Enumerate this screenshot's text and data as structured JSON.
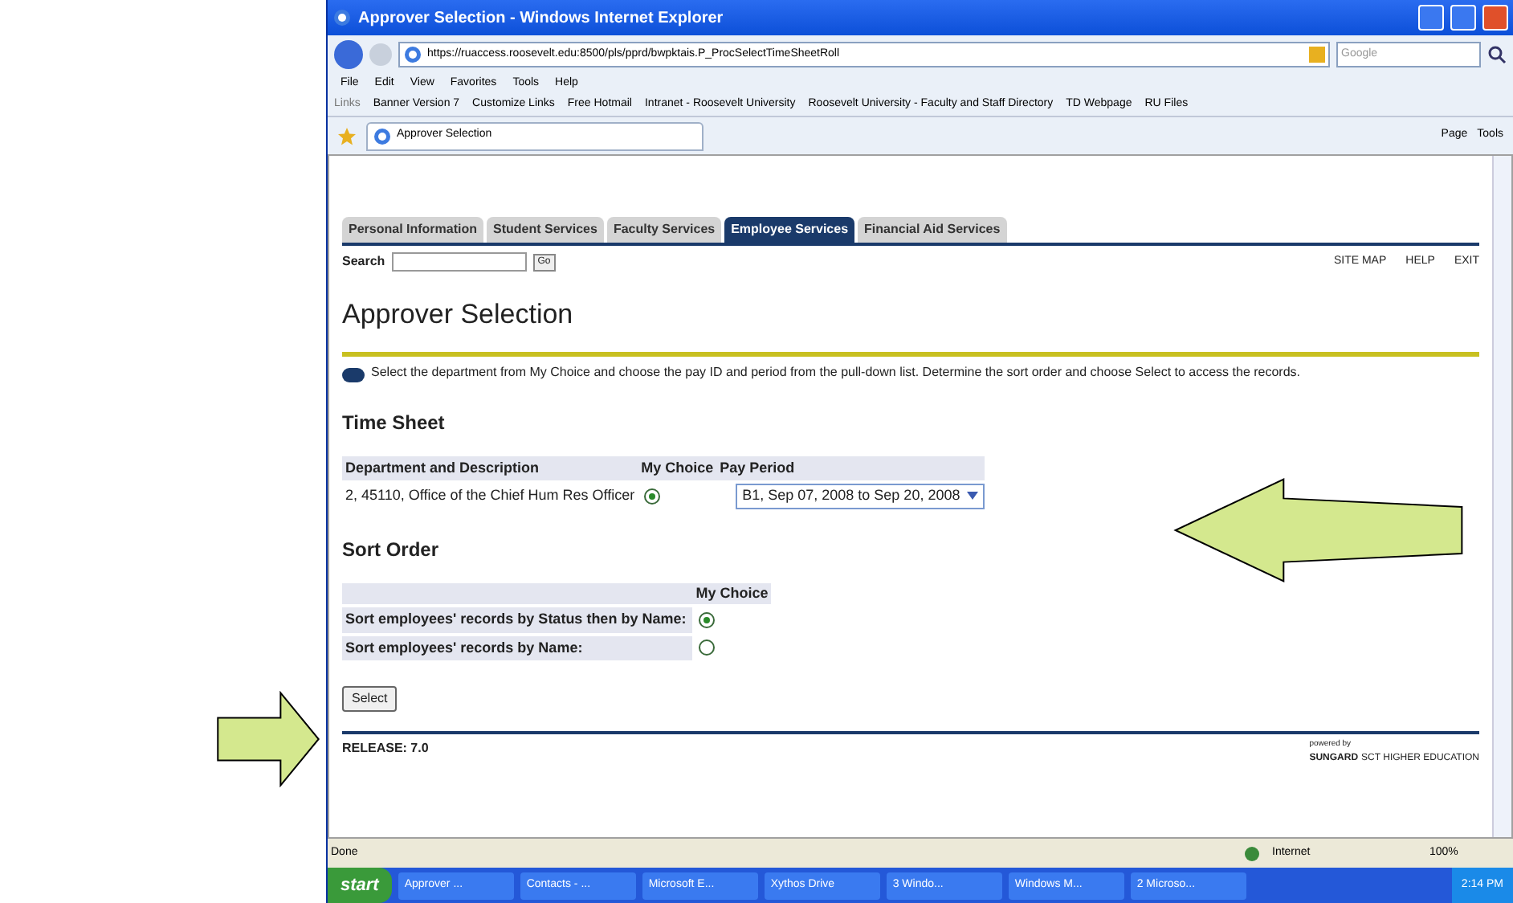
{
  "window": {
    "title": "Approver Selection - Windows Internet Explorer"
  },
  "address": {
    "url": "https://ruaccess.roosevelt.edu:8500/pls/pprd/bwpktais.P_ProcSelectTimeSheetRoll",
    "search_placeholder": "Google"
  },
  "menu": [
    "File",
    "Edit",
    "View",
    "Favorites",
    "Tools",
    "Help"
  ],
  "links": {
    "label": "Links",
    "items": [
      "Banner Version 7",
      "Customize Links",
      "Free Hotmail",
      "Intranet - Roosevelt University",
      "Roosevelt University - Faculty and Staff Directory",
      "TD Webpage",
      "RU Files"
    ]
  },
  "browser_tab": "Approver Selection",
  "command_bar": [
    "Page",
    "Tools"
  ],
  "nav_tabs": [
    {
      "label": "Personal Information",
      "selected": false
    },
    {
      "label": "Student Services",
      "selected": false
    },
    {
      "label": "Faculty Services",
      "selected": false
    },
    {
      "label": "Employee Services",
      "selected": true
    },
    {
      "label": "Financial Aid Services",
      "selected": false
    }
  ],
  "search": {
    "label": "Search",
    "button": "Go"
  },
  "top_links": [
    "SITE MAP",
    "HELP",
    "EXIT"
  ],
  "page_title": "Approver Selection",
  "info_text": "Select the department from My Choice and choose the pay ID and period from the pull-down list. Determine the sort order and choose Select to access the records.",
  "time_sheet": {
    "heading": "Time Sheet",
    "columns": [
      "Department and Description",
      "My Choice",
      "Pay Period"
    ],
    "rows": [
      {
        "department": "2, 45110, Office of the Chief Hum Res Officer",
        "selected": true,
        "pay_period": "B1, Sep 07, 2008 to Sep 20, 2008"
      }
    ]
  },
  "sort_order": {
    "heading": "Sort Order",
    "column": "My Choice",
    "options": [
      {
        "label": "Sort employees' records by Status then by Name:",
        "selected": true
      },
      {
        "label": "Sort employees' records by Name:",
        "selected": false
      }
    ]
  },
  "select_button": "Select",
  "release": "RELEASE: 7.0",
  "powered_by": {
    "caption": "powered by",
    "brand": "SUNGARD",
    "rest": "SCT HIGHER EDUCATION"
  },
  "status_bar": {
    "text": "Done",
    "zone": "Internet",
    "zoom": "100%"
  },
  "taskbar": {
    "start": "start",
    "items": [
      "Approver ...",
      "Contacts - ...",
      "Microsoft E...",
      "Xythos Drive",
      "3 Windo...",
      "Windows M...",
      "2 Microso..."
    ],
    "clock": "2:14 PM"
  }
}
